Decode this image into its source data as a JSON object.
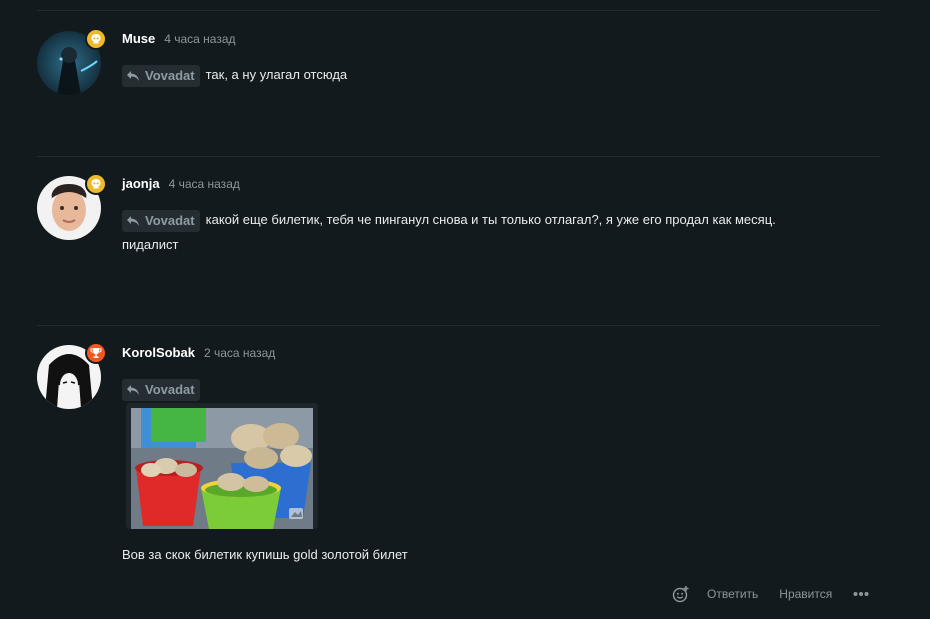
{
  "comments": [
    {
      "author": "Muse",
      "time": "4 часа назад",
      "reply_to": "Vovadat",
      "text_lines": [
        "так, а ну улагал отсюда"
      ],
      "badge": "skull"
    },
    {
      "author": "jaonja",
      "time": "4 часа назад",
      "reply_to": "Vovadat",
      "text_lines": [
        "какой еще билетик, тебя че пинганул снова и ты только отлагал?, я уже его продал как месяц.",
        "пидалист"
      ],
      "badge": "skull"
    },
    {
      "author": "KorolSobak",
      "time": "2 часа назад",
      "reply_to": "Vovadat",
      "text_lines": [
        "Вов за скок билетик купишь gold золотой билет"
      ],
      "badge": "trophy"
    }
  ],
  "actions": {
    "reply_label": "Ответить",
    "like_label": "Нравится"
  },
  "colors": {
    "background": "#131a1e",
    "badge_gold": "#f0b92c",
    "badge_red": "#f1581f",
    "muted_text": "#8c969c"
  }
}
